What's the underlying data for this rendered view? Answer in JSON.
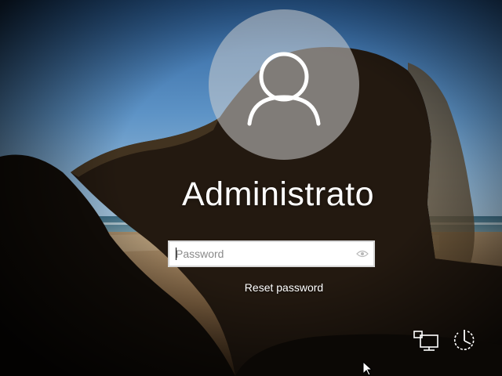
{
  "user": {
    "name": "Administrato"
  },
  "password": {
    "placeholder": "Password",
    "value": ""
  },
  "links": {
    "reset_password": "Reset password"
  },
  "icons": {
    "avatar": "user-silhouette-icon",
    "reveal": "eye-icon",
    "network": "network-icon",
    "power": "power-icon",
    "cursor": "mouse-pointer-icon"
  },
  "colors": {
    "text": "#ffffff",
    "input_bg": "#ffffff",
    "input_border": "#d8d8d8",
    "avatar_bg": "#cdcdcd"
  }
}
